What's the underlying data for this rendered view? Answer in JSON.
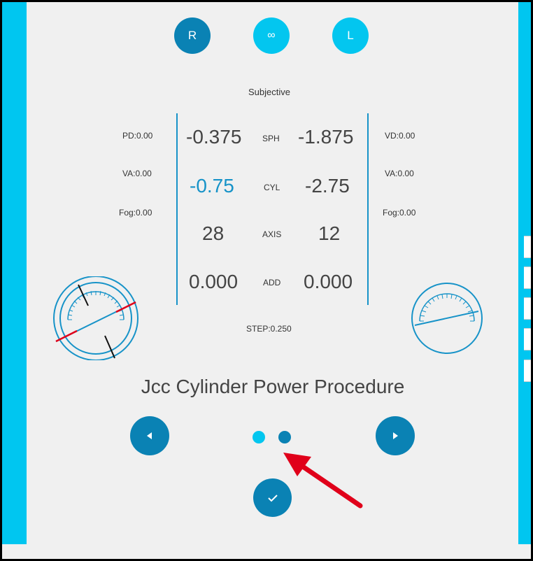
{
  "eye_selector": {
    "right": "R",
    "both": "∞",
    "left": "L"
  },
  "mode_label": "Subjective",
  "left_info": {
    "pd": "PD:0.00",
    "va": "VA:0.00",
    "fog": "Fog:0.00"
  },
  "right_info": {
    "vd": "VD:0.00",
    "va": "VA:0.00",
    "fog": "Fog:0.00"
  },
  "measurements": {
    "sph": {
      "label": "SPH",
      "right": "-0.375",
      "left": "-1.875"
    },
    "cyl": {
      "label": "CYL",
      "right": "-0.75",
      "left": "-2.75"
    },
    "axis": {
      "label": "AXIS",
      "right": "28",
      "left": "12"
    },
    "add": {
      "label": "ADD",
      "right": "0.000",
      "left": "0.000"
    }
  },
  "step": "STEP:0.250",
  "procedure_title": "Jcc Cylinder Power Procedure",
  "pagination": {
    "current": 1,
    "total": 2
  },
  "colors": {
    "sidebar": "#00c6f0",
    "primary_dark": "#0a82b4",
    "primary_light": "#03c6ef",
    "value_highlight": "#1793c8",
    "annotation_arrow": "#e0001a"
  },
  "icons": {
    "prev": "triangle-left-icon",
    "next": "triangle-right-icon",
    "confirm": "check-icon"
  }
}
